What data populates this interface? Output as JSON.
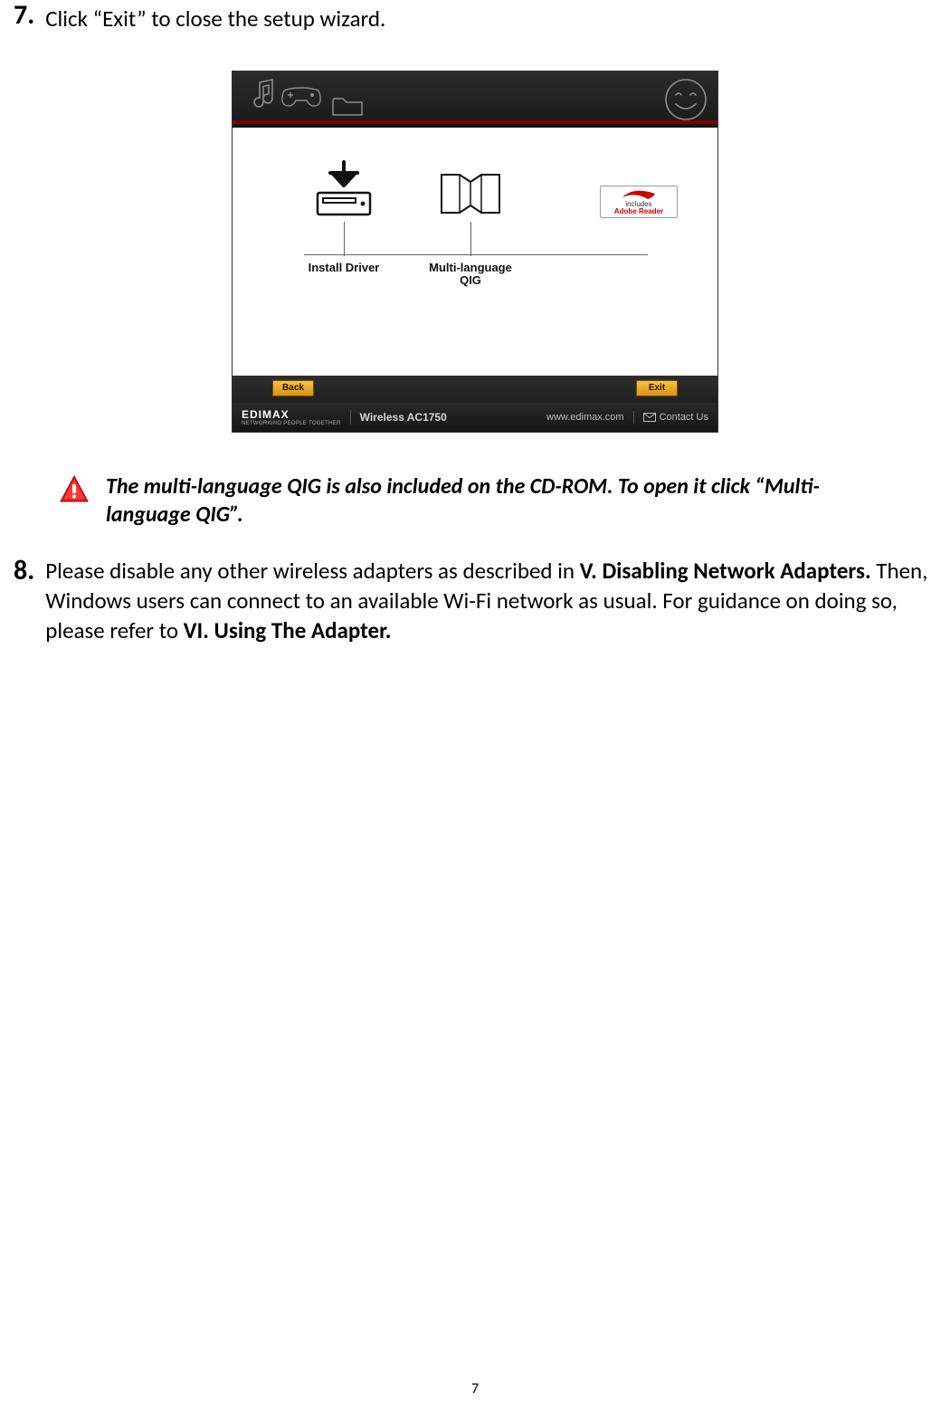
{
  "step7": {
    "num": "7.",
    "text": "Click “Exit” to close the setup wizard."
  },
  "wizard": {
    "install_label": "Install Driver",
    "qig_label_line1": "Multi-language",
    "qig_label_line2": "QIG",
    "adobe_includes": "includes",
    "adobe_brand": "Adobe",
    "adobe_reader": "Reader",
    "back": "Back",
    "exit": "Exit",
    "brand": "EDIMAX",
    "brand_sub": "NETWORKING PEOPLE TOGETHER",
    "product": "Wireless AC1750",
    "url": "www.edimax.com",
    "contact": "Contact Us"
  },
  "note": {
    "text": "The multi-language QIG is also included on the CD-ROM. To open it click “Multi-language QIG”."
  },
  "step8": {
    "num": "8.",
    "pre": "Please disable any other wireless adapters as described in ",
    "bold1": "V. Disabling Network Adapters.",
    "mid": " Then, Windows users can connect to an available Wi-Fi network as usual. For guidance on doing so, please refer to ",
    "bold2": "VI. Using The Adapter."
  },
  "page_number": "7"
}
